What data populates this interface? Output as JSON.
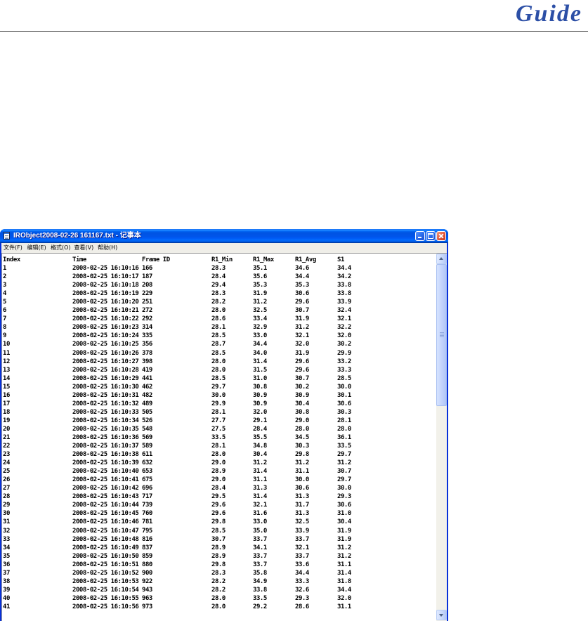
{
  "header": {
    "logo_text": "Guide"
  },
  "colors": {
    "logo": "#2c4fa6",
    "window_frame": "#0831d9",
    "title_bar": "#0054e3",
    "close_button": "#e2563a"
  },
  "icons": {
    "app": "notepad-icon",
    "minimize": "minimize-icon",
    "maximize": "maximize-icon",
    "close": "close-icon",
    "scroll_up": "arrow-up-icon",
    "scroll_down": "arrow-down-icon"
  },
  "notepad": {
    "title": "IRObject2008-02-26 161167.txt - 记事本",
    "menu": [
      "文件(F)",
      "编辑(E)",
      "格式(O)",
      "查看(V)",
      "帮助(H)"
    ],
    "columns": [
      "Index",
      "Time",
      "Frame ID",
      "R1_Min",
      "R1_Max",
      "R1_Avg",
      "S1"
    ],
    "rows": [
      [
        "1",
        "2008-02-25 16:10:16",
        "166",
        "28.3",
        "35.1",
        "34.6",
        "34.4"
      ],
      [
        "2",
        "2008-02-25 16:10:17",
        "187",
        "28.4",
        "35.6",
        "34.4",
        "34.2"
      ],
      [
        "3",
        "2008-02-25 16:10:18",
        "208",
        "29.4",
        "35.3",
        "35.3",
        "33.8"
      ],
      [
        "4",
        "2008-02-25 16:10:19",
        "229",
        "28.3",
        "31.9",
        "30.6",
        "33.8"
      ],
      [
        "5",
        "2008-02-25 16:10:20",
        "251",
        "28.2",
        "31.2",
        "29.6",
        "33.9"
      ],
      [
        "6",
        "2008-02-25 16:10:21",
        "272",
        "28.0",
        "32.5",
        "30.7",
        "32.4"
      ],
      [
        "7",
        "2008-02-25 16:10:22",
        "292",
        "28.6",
        "33.4",
        "31.9",
        "32.1"
      ],
      [
        "8",
        "2008-02-25 16:10:23",
        "314",
        "28.1",
        "32.9",
        "31.2",
        "32.2"
      ],
      [
        "9",
        "2008-02-25 16:10:24",
        "335",
        "28.5",
        "33.0",
        "32.1",
        "32.0"
      ],
      [
        "10",
        "2008-02-25 16:10:25",
        "356",
        "28.7",
        "34.4",
        "32.0",
        "30.2"
      ],
      [
        "11",
        "2008-02-25 16:10:26",
        "378",
        "28.5",
        "34.0",
        "31.9",
        "29.9"
      ],
      [
        "12",
        "2008-02-25 16:10:27",
        "398",
        "28.0",
        "31.4",
        "29.6",
        "33.2"
      ],
      [
        "13",
        "2008-02-25 16:10:28",
        "419",
        "28.0",
        "31.5",
        "29.6",
        "33.3"
      ],
      [
        "14",
        "2008-02-25 16:10:29",
        "441",
        "28.5",
        "31.0",
        "30.7",
        "28.5"
      ],
      [
        "15",
        "2008-02-25 16:10:30",
        "462",
        "29.7",
        "30.8",
        "30.2",
        "30.0"
      ],
      [
        "16",
        "2008-02-25 16:10:31",
        "482",
        "30.0",
        "30.9",
        "30.9",
        "30.1"
      ],
      [
        "17",
        "2008-02-25 16:10:32",
        "489",
        "29.9",
        "30.9",
        "30.4",
        "30.6"
      ],
      [
        "18",
        "2008-02-25 16:10:33",
        "505",
        "28.1",
        "32.0",
        "30.8",
        "30.3"
      ],
      [
        "19",
        "2008-02-25 16:10:34",
        "526",
        "27.7",
        "29.1",
        "29.0",
        "28.1"
      ],
      [
        "20",
        "2008-02-25 16:10:35",
        "548",
        "27.5",
        "28.4",
        "28.0",
        "28.0"
      ],
      [
        "21",
        "2008-02-25 16:10:36",
        "569",
        "33.5",
        "35.5",
        "34.5",
        "36.1"
      ],
      [
        "22",
        "2008-02-25 16:10:37",
        "589",
        "28.1",
        "34.8",
        "30.3",
        "33.5"
      ],
      [
        "23",
        "2008-02-25 16:10:38",
        "611",
        "28.0",
        "30.4",
        "29.8",
        "29.7"
      ],
      [
        "24",
        "2008-02-25 16:10:39",
        "632",
        "29.0",
        "31.2",
        "31.2",
        "31.2"
      ],
      [
        "25",
        "2008-02-25 16:10:40",
        "653",
        "28.9",
        "31.4",
        "31.1",
        "30.7"
      ],
      [
        "26",
        "2008-02-25 16:10:41",
        "675",
        "29.0",
        "31.1",
        "30.0",
        "29.7"
      ],
      [
        "27",
        "2008-02-25 16:10:42",
        "696",
        "28.4",
        "31.3",
        "30.6",
        "30.0"
      ],
      [
        "28",
        "2008-02-25 16:10:43",
        "717",
        "29.5",
        "31.4",
        "31.3",
        "29.3"
      ],
      [
        "29",
        "2008-02-25 16:10:44",
        "739",
        "29.6",
        "32.1",
        "31.7",
        "30.6"
      ],
      [
        "30",
        "2008-02-25 16:10:45",
        "760",
        "29.6",
        "31.6",
        "31.3",
        "31.0"
      ],
      [
        "31",
        "2008-02-25 16:10:46",
        "781",
        "29.8",
        "33.0",
        "32.5",
        "30.4"
      ],
      [
        "32",
        "2008-02-25 16:10:47",
        "795",
        "28.5",
        "35.0",
        "33.9",
        "31.9"
      ],
      [
        "33",
        "2008-02-25 16:10:48",
        "816",
        "30.7",
        "33.7",
        "33.7",
        "31.9"
      ],
      [
        "34",
        "2008-02-25 16:10:49",
        "837",
        "28.9",
        "34.1",
        "32.1",
        "31.2"
      ],
      [
        "35",
        "2008-02-25 16:10:50",
        "859",
        "28.9",
        "33.7",
        "33.7",
        "31.2"
      ],
      [
        "36",
        "2008-02-25 16:10:51",
        "880",
        "29.8",
        "33.7",
        "33.6",
        "31.1"
      ],
      [
        "37",
        "2008-02-25 16:10:52",
        "900",
        "28.3",
        "35.8",
        "34.4",
        "31.4"
      ],
      [
        "38",
        "2008-02-25 16:10:53",
        "922",
        "28.2",
        "34.9",
        "33.3",
        "31.8"
      ],
      [
        "39",
        "2008-02-25 16:10:54",
        "943",
        "28.2",
        "33.8",
        "32.6",
        "34.4"
      ],
      [
        "40",
        "2008-02-25 16:10:55",
        "963",
        "28.0",
        "33.5",
        "29.3",
        "32.0"
      ],
      [
        "41",
        "2008-02-25 16:10:56",
        "973",
        "28.0",
        "29.2",
        "28.6",
        "31.1"
      ]
    ],
    "scrollbar": {
      "position": 0,
      "visible_fraction": 0.41
    }
  }
}
